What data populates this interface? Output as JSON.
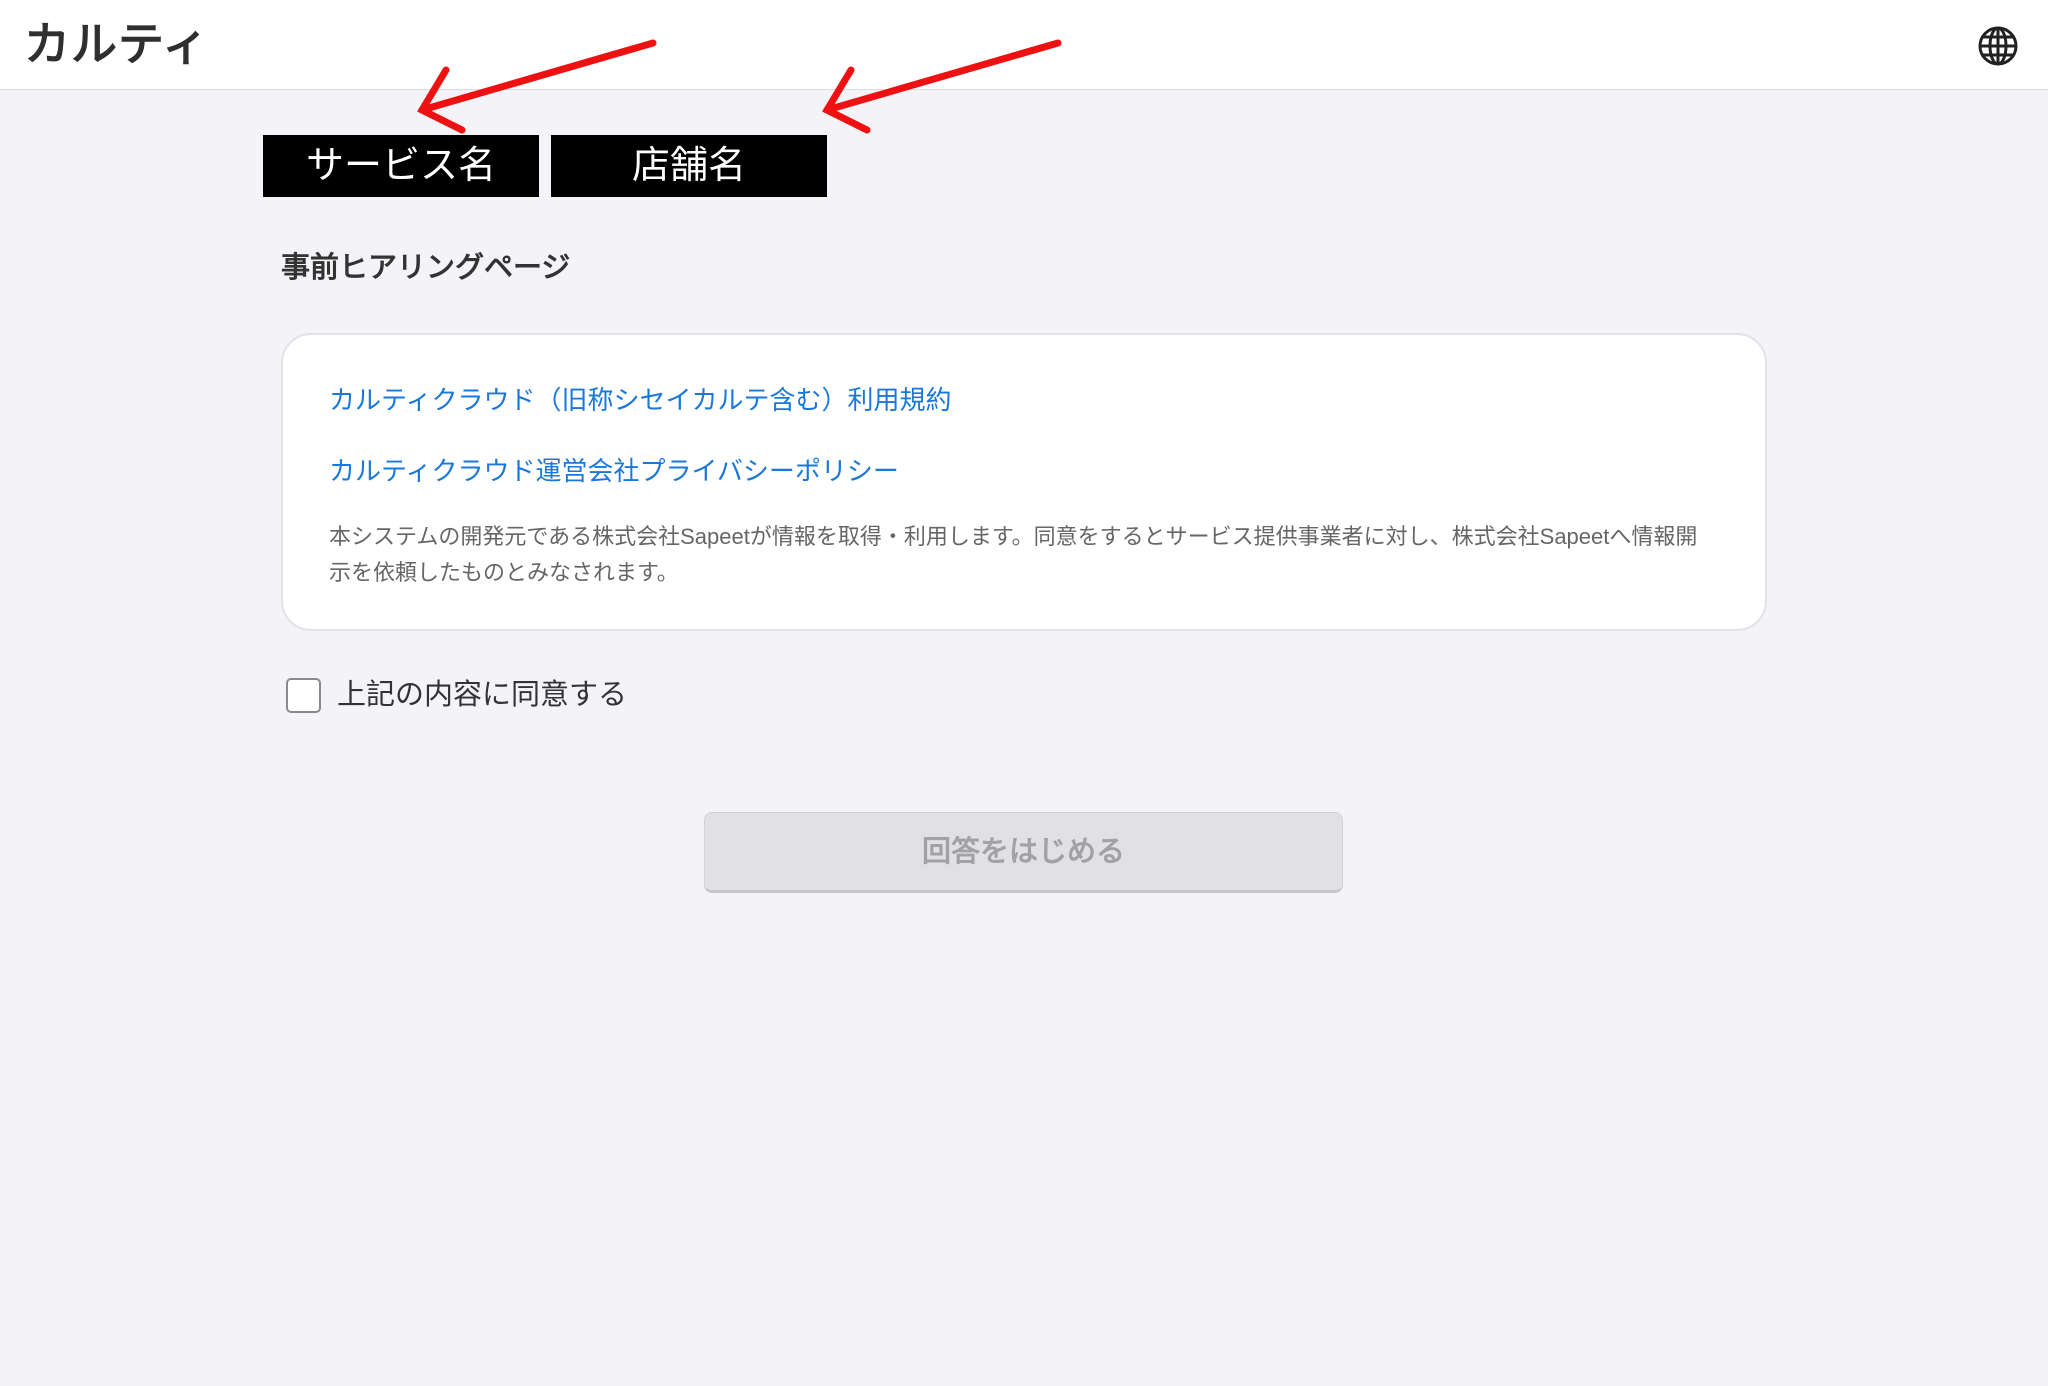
{
  "header": {
    "logo": "カルティ",
    "language_icon": "globe-icon"
  },
  "redaction_labels": {
    "service_name": "サービス名",
    "store_name": "店舗名"
  },
  "annotation": {
    "arrow_color": "#ee1111"
  },
  "page_title": "事前ヒアリングページ",
  "terms_card": {
    "links": [
      "カルティクラウド（旧称シセイカルテ含む）利用規約",
      "カルティクラウド運営会社プライバシーポリシー"
    ],
    "notice": "本システムの開発元である株式会社Sapeetが情報を取得・利用します。同意をするとサービス提供事業者に対し、株式会社Sapeetへ情報開示を依頼したものとみなされます。"
  },
  "agreement": {
    "label": "上記の内容に同意する",
    "checked": false
  },
  "start_button": {
    "label": "回答をはじめる",
    "disabled": true
  },
  "colors": {
    "background": "#f4f3f8",
    "link": "#1a78db",
    "button_disabled_bg": "#e1e1e5",
    "button_disabled_text": "#a1a1a6"
  }
}
